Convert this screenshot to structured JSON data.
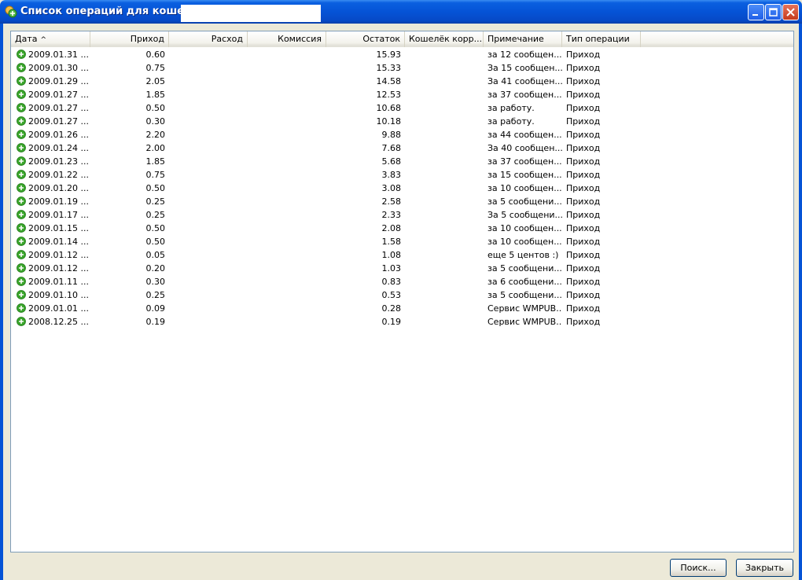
{
  "window": {
    "title": "Список операций для кошелька"
  },
  "colors": {
    "title_bar": "#0553d6",
    "income_icon": "#3aa52b"
  },
  "columns": [
    {
      "label": "Дата",
      "sort_indicator": "^"
    },
    {
      "label": "Приход"
    },
    {
      "label": "Расход"
    },
    {
      "label": "Комиссия"
    },
    {
      "label": "Остаток"
    },
    {
      "label": "Кошелёк корр..."
    },
    {
      "label": "Примечание"
    },
    {
      "label": "Тип операции"
    }
  ],
  "rows": [
    {
      "date": "2009.01.31 ...",
      "income": "0.60",
      "balance": "15.93",
      "note": "за 12 сообщен...",
      "type": "Приход"
    },
    {
      "date": "2009.01.30 ...",
      "income": "0.75",
      "balance": "15.33",
      "note": "За 15 сообщен...",
      "type": "Приход"
    },
    {
      "date": "2009.01.29 ...",
      "income": "2.05",
      "balance": "14.58",
      "note": "За 41 сообщен...",
      "type": "Приход"
    },
    {
      "date": "2009.01.27 ...",
      "income": "1.85",
      "balance": "12.53",
      "note": "за 37 сообщен...",
      "type": "Приход"
    },
    {
      "date": "2009.01.27 ...",
      "income": "0.50",
      "balance": "10.68",
      "note": "за работу.",
      "type": "Приход"
    },
    {
      "date": "2009.01.27 ...",
      "income": "0.30",
      "balance": "10.18",
      "note": "за работу.",
      "type": "Приход"
    },
    {
      "date": "2009.01.26 ...",
      "income": "2.20",
      "balance": "9.88",
      "note": "за 44 сообщен...",
      "type": "Приход"
    },
    {
      "date": "2009.01.24 ...",
      "income": "2.00",
      "balance": "7.68",
      "note": "За 40 сообщен...",
      "type": "Приход"
    },
    {
      "date": "2009.01.23 ...",
      "income": "1.85",
      "balance": "5.68",
      "note": "за 37 сообщен...",
      "type": "Приход"
    },
    {
      "date": "2009.01.22 ...",
      "income": "0.75",
      "balance": "3.83",
      "note": "за 15 сообщен...",
      "type": "Приход"
    },
    {
      "date": "2009.01.20 ...",
      "income": "0.50",
      "balance": "3.08",
      "note": "за 10 сообщен...",
      "type": "Приход"
    },
    {
      "date": "2009.01.19 ...",
      "income": "0.25",
      "balance": "2.58",
      "note": "за 5 сообщени...",
      "type": "Приход"
    },
    {
      "date": "2009.01.17 ...",
      "income": "0.25",
      "balance": "2.33",
      "note": "За 5 сообщени...",
      "type": "Приход"
    },
    {
      "date": "2009.01.15 ...",
      "income": "0.50",
      "balance": "2.08",
      "note": "за 10 сообщен...",
      "type": "Приход"
    },
    {
      "date": "2009.01.14 ...",
      "income": "0.50",
      "balance": "1.58",
      "note": "за 10 сообщен...",
      "type": "Приход"
    },
    {
      "date": "2009.01.12 ...",
      "income": "0.05",
      "balance": "1.08",
      "note": "еще 5 центов :)",
      "type": "Приход"
    },
    {
      "date": "2009.01.12 ...",
      "income": "0.20",
      "balance": "1.03",
      "note": "за 5 сообщени...",
      "type": "Приход"
    },
    {
      "date": "2009.01.11 ...",
      "income": "0.30",
      "balance": "0.83",
      "note": "за 6 сообщени...",
      "type": "Приход"
    },
    {
      "date": "2009.01.10 ...",
      "income": "0.25",
      "balance": "0.53",
      "note": "за 5 сообщени...",
      "type": "Приход"
    },
    {
      "date": "2009.01.01 ...",
      "income": "0.09",
      "balance": "0.28",
      "note": "Сервис WMPUB...",
      "type": "Приход"
    },
    {
      "date": "2008.12.25 ...",
      "income": "0.19",
      "balance": "0.19",
      "note": "Сервис WMPUB...",
      "type": "Приход"
    }
  ],
  "buttons": {
    "search": "Поиск...",
    "close": "Закрыть"
  }
}
